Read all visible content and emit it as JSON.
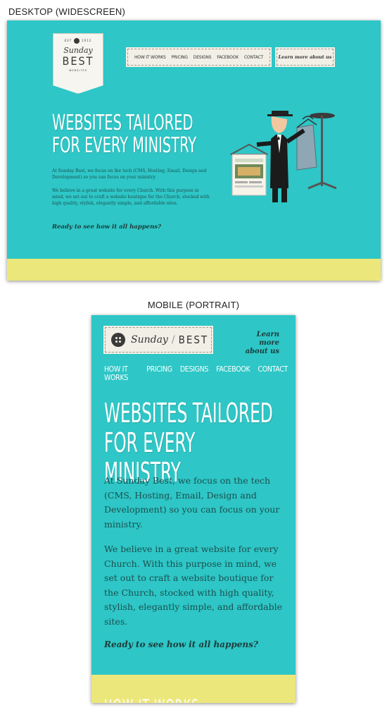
{
  "captions": {
    "desktop": "DESKTOP (WIDESCREEN)",
    "mobile": "MOBILE (PORTRAIT)"
  },
  "colors": {
    "teal": "#2ec6c6",
    "yellow": "#ece77a",
    "paper": "#f1efe6"
  },
  "brand": {
    "sunday": "Sunday",
    "best": "BEST",
    "est": "EST",
    "websites": "WEBSITES"
  },
  "nav": {
    "items": [
      "HOW IT WORKS",
      "PRICING",
      "DESIGNS",
      "FACEBOOK",
      "CONTACT"
    ],
    "learn_more": "Learn more about us"
  },
  "hero": {
    "title_line1": "WEBSITES TAILORED",
    "title_line2": "FOR EVERY MINISTRY",
    "p1": "At Sunday Best, we focus on the tech (CMS, Hosting, Email, Design and Development) so you can focus on your ministry.",
    "p2": "We believe in a great website for every Church. With this purpose in mind, we set out to craft a website boutique for the Church, stocked with high quality, stylish, elegantly simple, and affordable sites.",
    "cta": "Ready to see how it all happens?"
  },
  "mobile": {
    "learn_line1": "Learn more",
    "learn_line2": "about us",
    "footer_title": "HOW IT WORKS"
  }
}
